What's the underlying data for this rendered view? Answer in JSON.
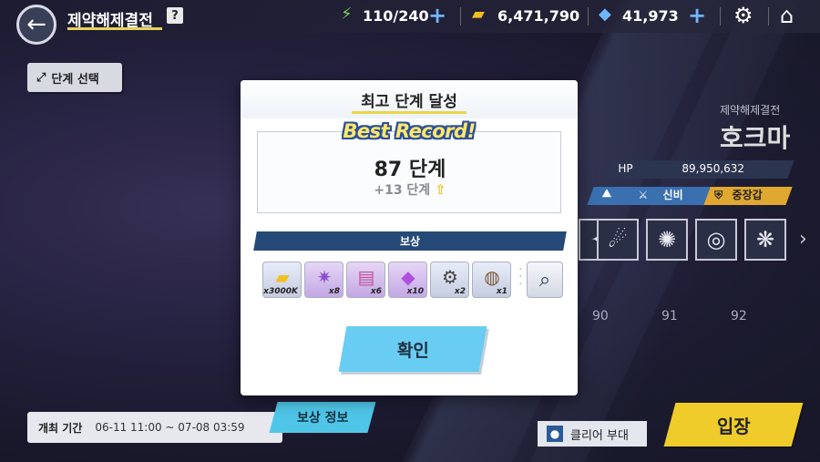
{
  "header": {
    "title": "제약해제결전",
    "help": "?",
    "stamina": "110/240",
    "gold": "6,471,790",
    "gems": "41,973"
  },
  "left": {
    "stage_select": "단계 선택",
    "period_label": "개최 기간",
    "period_value": "06-11 11:00 ~ 07-08 03:59",
    "reward_info": "보상 정보"
  },
  "boss": {
    "subtitle": "제약해제결전",
    "name": "호크마",
    "hp_label": "HP",
    "hp_value": "89,950,632",
    "tags": [
      "신비",
      "중장갑"
    ],
    "stage_numbers": [
      "90",
      "91",
      "92"
    ]
  },
  "bottom_right": {
    "clear_team": "클리어 부대",
    "enter": "입장"
  },
  "modal": {
    "title": "최고 단계 달성",
    "banner": "Best Record!",
    "record": "87 단계",
    "improvement": "+13 단계",
    "reward_header": "보상",
    "rewards": [
      {
        "icon": "credit-ticket-icon",
        "qty": "x3000K"
      },
      {
        "icon": "purple-orb-icon",
        "qty": "x8"
      },
      {
        "icon": "report-book-icon",
        "qty": "x6"
      },
      {
        "icon": "purple-crystal-icon",
        "qty": "x10"
      },
      {
        "icon": "gear-disc-icon",
        "qty": "x2"
      },
      {
        "icon": "ring-artifact-icon",
        "qty": "x1"
      }
    ],
    "confirm": "확인"
  }
}
